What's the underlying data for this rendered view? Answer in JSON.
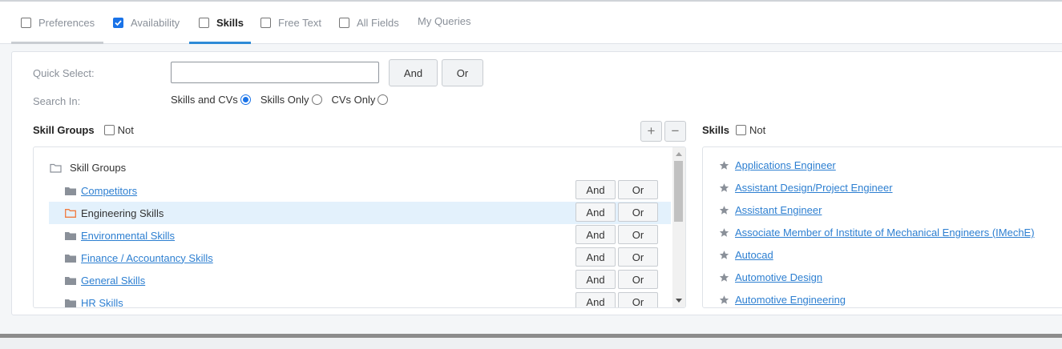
{
  "tabs": [
    {
      "label": "Preferences",
      "checkbox": true,
      "checked": false,
      "state": "visited"
    },
    {
      "label": "Availability",
      "checkbox": true,
      "checked": true,
      "state": "normal"
    },
    {
      "label": "Skills",
      "checkbox": true,
      "checked": false,
      "state": "active"
    },
    {
      "label": "Free Text",
      "checkbox": true,
      "checked": false,
      "state": "normal"
    },
    {
      "label": "All Fields",
      "checkbox": true,
      "checked": false,
      "state": "normal"
    },
    {
      "label": "My Queries",
      "checkbox": false,
      "checked": false,
      "state": "normal"
    }
  ],
  "quick_select": {
    "label": "Quick Select:",
    "value": "",
    "placeholder": "",
    "and_label": "And",
    "or_label": "Or"
  },
  "search_in": {
    "label": "Search In:",
    "options": [
      {
        "label": "Skills and CVs",
        "selected": true
      },
      {
        "label": "Skills Only",
        "selected": false
      },
      {
        "label": "CVs Only",
        "selected": false
      }
    ]
  },
  "skill_groups": {
    "title": "Skill Groups",
    "not_label": "Not",
    "expand_label": "+",
    "collapse_label": "−",
    "root_label": "Skill Groups",
    "and_label": "And",
    "or_label": "Or",
    "items": [
      {
        "label": "Competitors",
        "selected": false
      },
      {
        "label": "Engineering Skills",
        "selected": true
      },
      {
        "label": "Environmental Skills",
        "selected": false
      },
      {
        "label": "Finance / Accountancy Skills",
        "selected": false
      },
      {
        "label": "General Skills",
        "selected": false
      },
      {
        "label": "HR Skills",
        "selected": false
      }
    ]
  },
  "skills": {
    "title": "Skills",
    "not_label": "Not",
    "items": [
      "Applications Engineer",
      "Assistant Design/Project Engineer",
      "Assistant Engineer",
      "Associate Member of Institute of Mechanical Engineers (IMechE)",
      "Autocad",
      "Automotive Design",
      "Automotive Engineering"
    ]
  },
  "colors": {
    "accent": "#2d8ad6",
    "link": "#2d7fd1",
    "selected_row": "#e3f1fc",
    "selected_folder": "#f07b3f",
    "folder": "#8a9099"
  }
}
